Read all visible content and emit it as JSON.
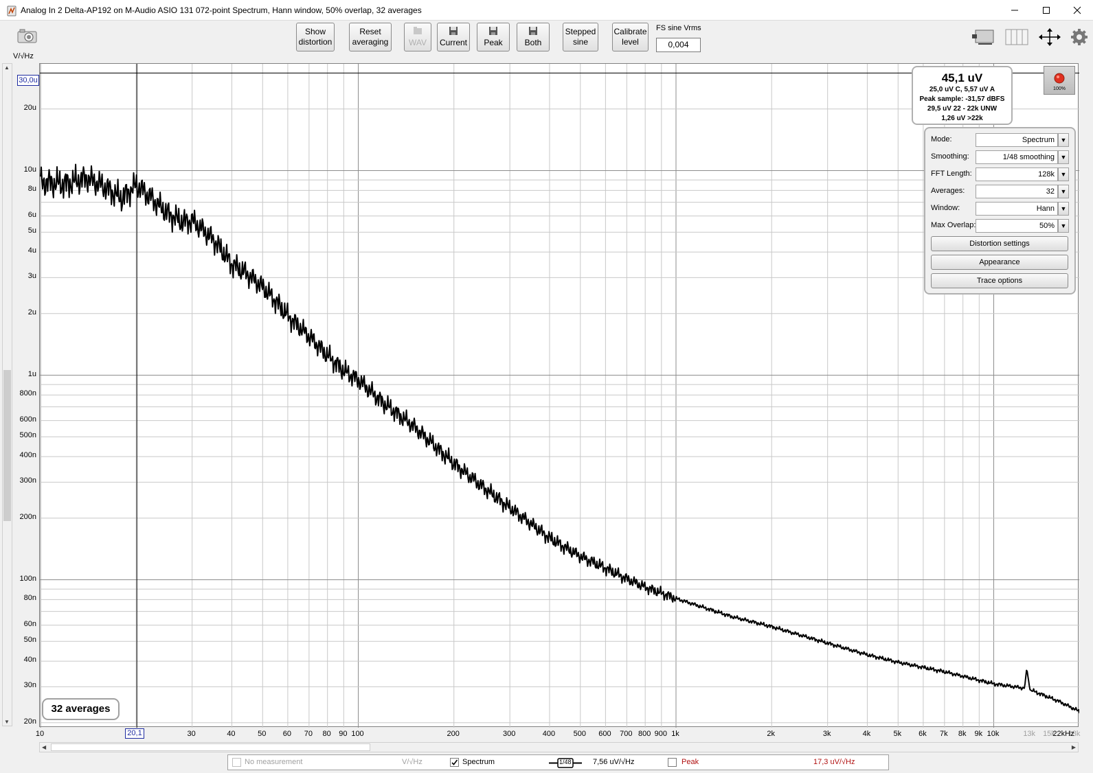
{
  "window": {
    "title": "Analog In 2 Delta-AP192 on M-Audio ASIO 131 072-point Spectrum, Hann window, 50% overlap, 32 averages"
  },
  "toolbar": {
    "show_distortion": "Show\ndistortion",
    "reset_averaging": "Reset\naveraging",
    "wav": "WAV",
    "current": "Current",
    "peak": "Peak",
    "both": "Both",
    "stepped_sine": "Stepped\nsine",
    "calibrate_level": "Calibrate\nlevel",
    "fs_label": "FS sine Vrms",
    "fs_value": "0,004"
  },
  "plot": {
    "y_unit": "V/√Hz",
    "y_cursor": "30,0u",
    "x_cursor": "20,1",
    "y_ticks": [
      "20u",
      "10u",
      "8u",
      "6u",
      "5u",
      "4u",
      "3u",
      "2u",
      "1u",
      "800n",
      "600n",
      "500n",
      "400n",
      "300n",
      "200n",
      "100n",
      "80n",
      "60n",
      "50n",
      "40n",
      "30n",
      "20n"
    ],
    "x_ticks": [
      "10",
      "30",
      "40",
      "50",
      "60",
      "70",
      "80",
      "90",
      "100",
      "200",
      "300",
      "400",
      "500",
      "600",
      "700",
      "800",
      "900",
      "1k",
      "2k",
      "3k",
      "4k",
      "5k",
      "6k",
      "7k",
      "8k",
      "9k",
      "10k",
      "13k",
      "15k",
      "18k",
      "22kHz"
    ],
    "averages_badge": "32 averages",
    "trace_color": "#000000",
    "grid_color": "#c8c8c8"
  },
  "chart_data": {
    "type": "line",
    "title": "",
    "xlabel": "",
    "ylabel": "V/√Hz",
    "x_scale": "log",
    "y_scale": "log",
    "xlim": [
      10,
      24000
    ],
    "ylim": [
      1.8e-08,
      3.3e-05
    ],
    "grid": true,
    "series": [
      {
        "x": [
          10,
          12,
          14,
          16,
          18,
          20,
          22,
          25,
          28,
          30,
          35,
          40,
          45,
          50,
          55,
          60,
          70,
          80,
          90,
          100,
          120,
          150,
          200,
          250,
          300,
          400,
          500,
          600,
          700,
          800,
          1000,
          1500,
          2000,
          3000,
          4000,
          5000,
          7000,
          10000,
          12500,
          12700,
          13000,
          16000,
          20000,
          24000
        ],
        "y": [
          8.8e-06,
          8.6e-06,
          9.2e-06,
          8.3e-06,
          7.3e-06,
          8.5e-06,
          7.5e-06,
          6.2e-06,
          5.6e-06,
          5.7e-06,
          4.6e-06,
          3.5e-06,
          3.1e-06,
          2.7e-06,
          2.3e-06,
          1.95e-06,
          1.55e-06,
          1.25e-06,
          1.05e-06,
          9.5e-07,
          7.3e-07,
          5.6e-07,
          3.7e-07,
          2.8e-07,
          2.25e-07,
          1.6e-07,
          1.3e-07,
          1.14e-07,
          1.01e-07,
          9.2e-08,
          8.1e-08,
          6.6e-08,
          5.9e-08,
          4.9e-08,
          4.3e-08,
          3.95e-08,
          3.55e-08,
          3.1e-08,
          2.95e-08,
          3.7e-08,
          2.9e-08,
          2.55e-08,
          2.15e-08,
          1.9e-08
        ]
      }
    ]
  },
  "readout": {
    "main": "45,1 uV",
    "line1": "25,0 uV C, 5,57 uV A",
    "line2": "Peak sample: -31,57 dBFS",
    "line3": "29,5 uV 22 - 22k UNW",
    "line4": "1,26 uV >22k"
  },
  "record": {
    "label": "100%",
    "color": "#e03020"
  },
  "settings": {
    "mode_label": "Mode:",
    "mode_value": "Spectrum",
    "smoothing_label": "Smoothing:",
    "smoothing_value": "1/48 smoothing",
    "fft_label": "FFT Length:",
    "fft_value": "128k",
    "averages_label": "Averages:",
    "averages_value": "32",
    "window_label": "Window:",
    "window_value": "Hann",
    "overlap_label": "Max Overlap:",
    "overlap_value": "50%",
    "distortion_settings": "Distortion settings",
    "appearance": "Appearance",
    "trace_options": "Trace options"
  },
  "legend": {
    "no_measurement": "No measurement",
    "no_measurement_unit": "V/√Hz",
    "spectrum": "Spectrum",
    "spectrum_smoothing": "1/48",
    "spectrum_value": "7,56 uV/√Hz",
    "peak": "Peak",
    "peak_value": "17,3 uV/√Hz"
  }
}
